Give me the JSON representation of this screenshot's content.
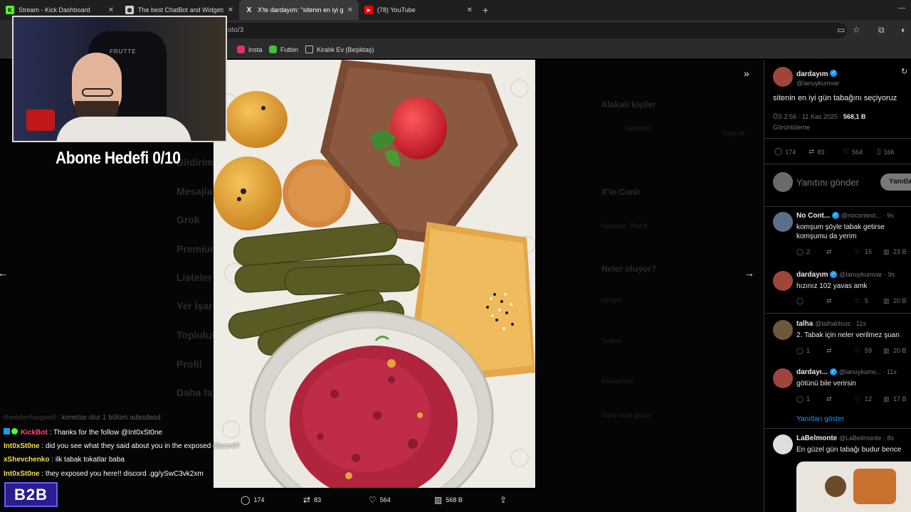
{
  "browser": {
    "tabs": [
      {
        "label": "Stream - Kick Dashboard",
        "color": "#53fc18",
        "glyph": "K"
      },
      {
        "label": "The best ChatBot and Widgets",
        "color": "#5a5a5a",
        "glyph": "⬢"
      },
      {
        "label": "X'te dardayım: \"sitenin en iyi gü",
        "color": "#000000",
        "glyph": "X"
      },
      {
        "label": "(78) YouTube",
        "color": "#ff0000",
        "glyph": "▶"
      }
    ],
    "url": "oto/3",
    "bookmarks": [
      {
        "label": "Insta",
        "color": "#e1306c"
      },
      {
        "label": "Futbin",
        "color": "#3fbf3f"
      },
      {
        "label": "Kiralık Ev (Beşiktaş)",
        "color": "#3a3a3a"
      }
    ]
  },
  "background_page": {
    "nav": [
      "Bildirimler",
      "Mesajlar",
      "Grok",
      "Premium",
      "Listeler",
      "Yer İşaretleri",
      "Topluluklar",
      "Profil",
      "Daha fazla"
    ],
    "right_titles": [
      "Alakalı kişiler",
      "X'te Canlı",
      "Neler oluyor?"
    ],
    "right_small": [
      "dardayım",
      "Takip et",
      "#deprem, Prof K",
      "Uçağın",
      "Sorkan",
      "#deliamsak",
      "Daha fazla göster"
    ]
  },
  "media": {
    "actions": {
      "replies": "174",
      "retweets": "83",
      "likes": "564",
      "views": "568 B"
    }
  },
  "tweet": {
    "author_name": "dardayım",
    "author_handle": "@lanuykumvar",
    "text": "sitenin en iyi gün tabağını seçiyoruz",
    "timestamp": "ÖS 2:56 · 11 Kas 2025 ·",
    "views_count": "568,1 B",
    "views_label": "Görüntüleme",
    "stats": {
      "replies": "174",
      "retweets": "83",
      "likes": "564",
      "bookmarks": "166"
    },
    "reply_placeholder": "Yanıtını gönder",
    "reply_button": "Yanıtla"
  },
  "replies": [
    {
      "name": "No Cont...",
      "handle": "@nocontext...",
      "time": "· 9s",
      "text": "komşum şöyle tabak getirse komşumu da yerim",
      "replies": "2",
      "retweets": "",
      "likes": "15",
      "views": "23 B",
      "color": "#5b6f8a"
    },
    {
      "name": "dardayım",
      "handle": "@lanuykumvar",
      "time": "· 9s",
      "text": "hızınız 102 yavas amk",
      "replies": "",
      "retweets": "",
      "likes": "5",
      "views": "20 B",
      "color": "#a0453a"
    },
    {
      "name": "talha",
      "handle": "@talhablsus",
      "time": "· 11s",
      "text": "2. Tabak için neler verilmez şuan",
      "replies": "1",
      "retweets": "",
      "likes": "59",
      "views": "20 B",
      "color": "#6a5a3a"
    },
    {
      "name": "dardayı...",
      "handle": "@lanuykumv...",
      "time": "· 11s",
      "text": "götünü bile verirsin",
      "replies": "1",
      "retweets": "",
      "likes": "12",
      "views": "17 B",
      "color": "#a0453a"
    }
  ],
  "show_replies": "Yanıtları göster",
  "last_reply": {
    "name": "LaBelmonte",
    "handle": "@LaBellmonte",
    "time": "· 8s",
    "text": "En güzel gün tabağı budur bence"
  },
  "overlay": {
    "goal": "Abone Hedefi 0/10",
    "chat": [
      {
        "user": "theoderhaqwell",
        "msg": " : kımetse olur 1 bölüm adasdasd",
        "color": "#555555",
        "faded": true
      },
      {
        "user": "KickBot",
        "msg": " : Thanks for the follow @Int0xSt0ne",
        "color": "#ff4d6d",
        "faded": false
      },
      {
        "user": "Int0xSt0ne",
        "msg": " : did you see what they said about you in the exposed discord?",
        "color": "#f4e04d",
        "faded": false
      },
      {
        "user": "xShevchenko",
        "msg": " : ilk tabak tokatlar baba",
        "color": "#f4e04d",
        "faded": false
      },
      {
        "user": "Int0xSt0ne",
        "msg": " : they exposed you here!! discord .gg/ySwC3vk2xm",
        "color": "#f4e04d",
        "faded": false
      }
    ],
    "logo": "B2B",
    "webcam_brand": "FRUTTE"
  }
}
